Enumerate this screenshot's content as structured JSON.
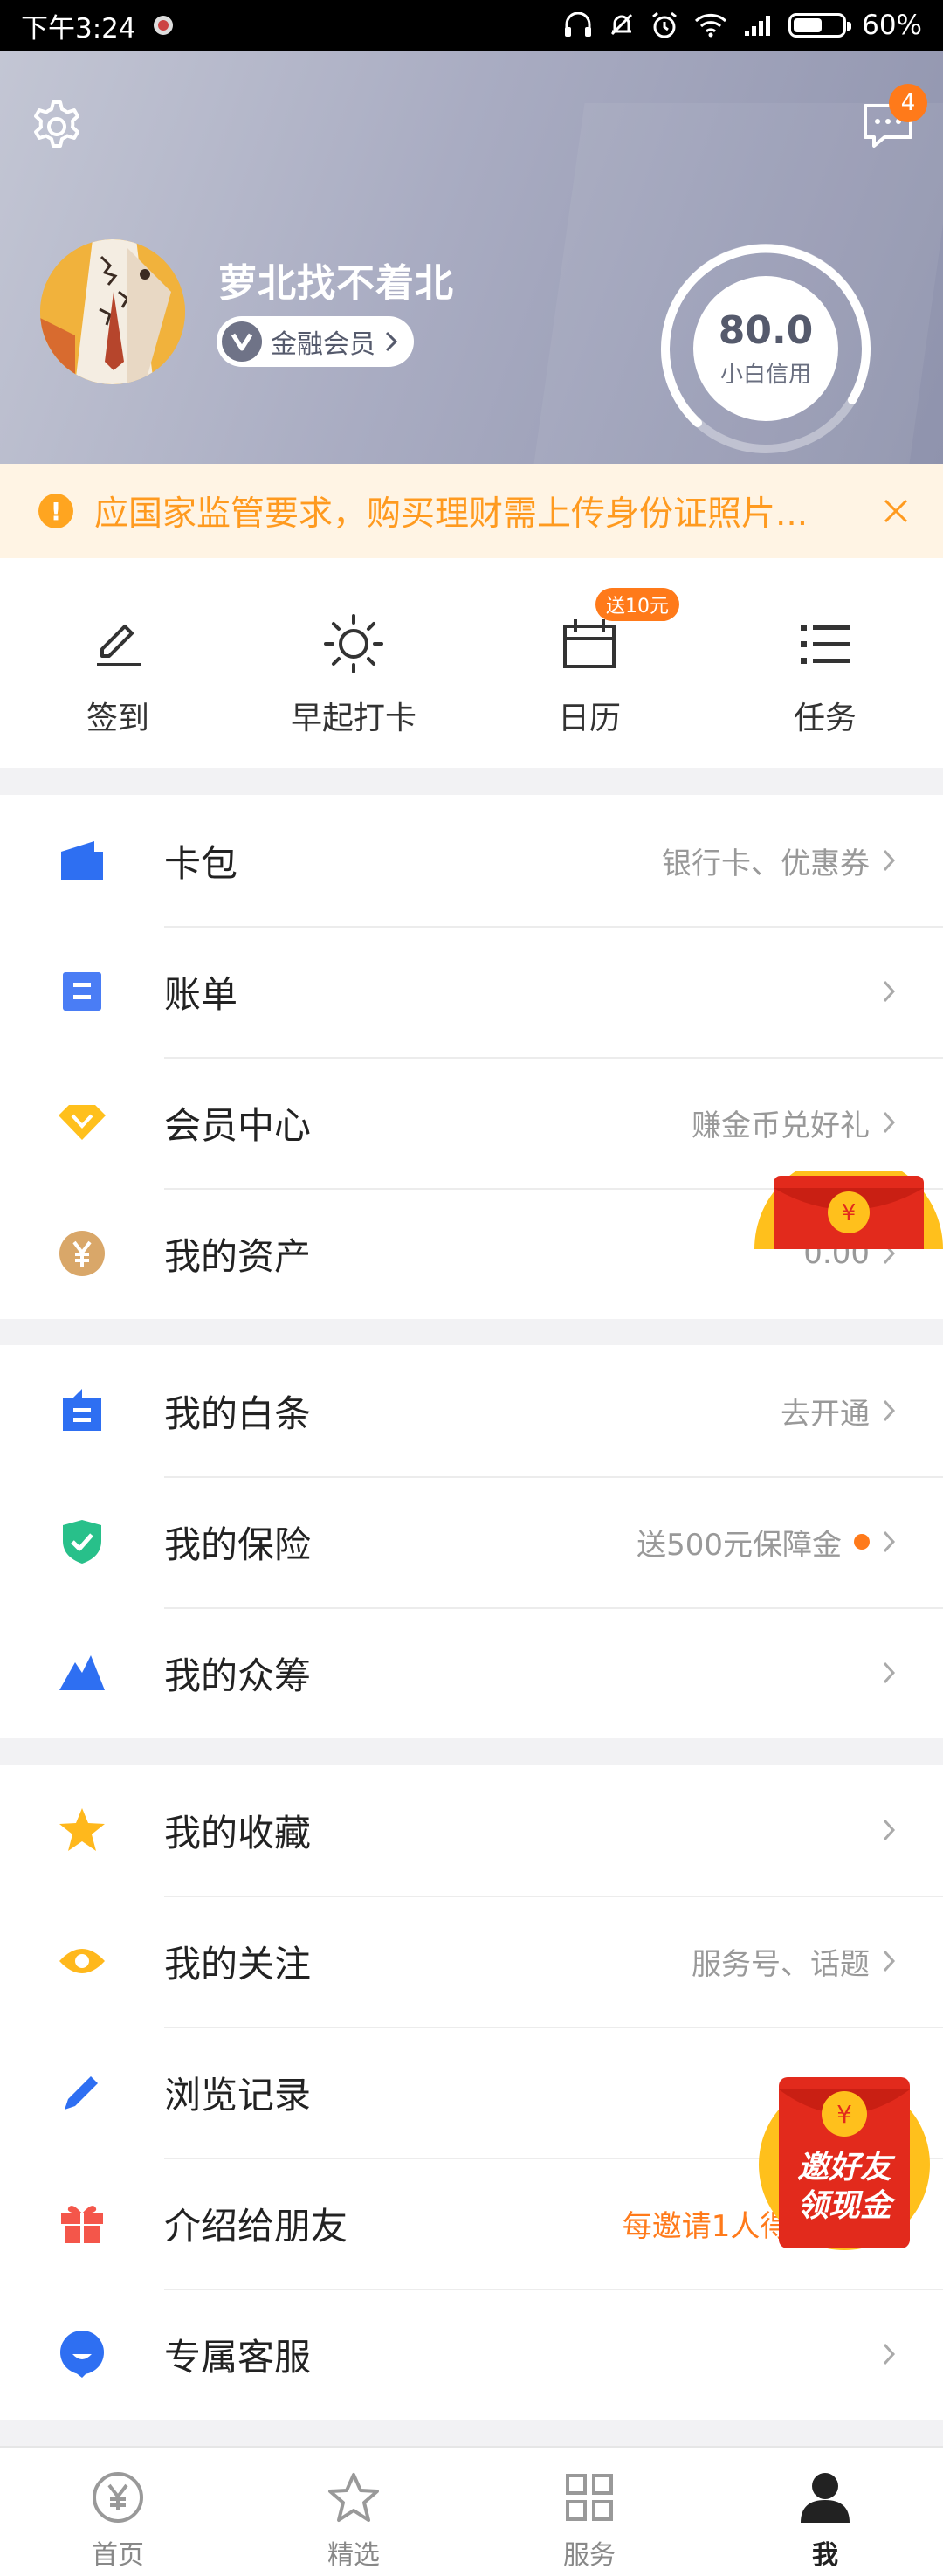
{
  "status_bar": {
    "time": "下午3:24",
    "battery": "60%"
  },
  "header": {
    "username": "萝北找不着北",
    "member_label": "金融会员",
    "message_count": "4",
    "credit_score": "80.0",
    "credit_label": "小白信用"
  },
  "notice": {
    "text": "应国家监管要求，购买理财需上传身份证照片..."
  },
  "quick_actions": [
    {
      "label": "签到",
      "icon": "pen-icon"
    },
    {
      "label": "早起打卡",
      "icon": "sun-icon"
    },
    {
      "label": "日历",
      "icon": "calendar-icon",
      "badge": "送10元"
    },
    {
      "label": "任务",
      "icon": "list-icon"
    }
  ],
  "section1": [
    {
      "title": "卡包",
      "sub": "银行卡、优惠券",
      "icon": "wallet-icon"
    },
    {
      "title": "账单",
      "sub": "",
      "icon": "bill-icon"
    },
    {
      "title": "会员中心",
      "sub": "赚金币兑好礼",
      "icon": "diamond-icon"
    },
    {
      "title": "我的资产",
      "sub": "0.00",
      "icon": "yuan-coin-icon"
    }
  ],
  "section2": [
    {
      "title": "我的白条",
      "sub": "去开通",
      "icon": "ious-icon"
    },
    {
      "title": "我的保险",
      "sub": "送500元保障金",
      "icon": "shield-check-icon"
    },
    {
      "title": "我的众筹",
      "sub": "",
      "icon": "mountain-icon"
    }
  ],
  "section3": [
    {
      "title": "我的收藏",
      "sub": "",
      "icon": "star-icon"
    },
    {
      "title": "我的关注",
      "sub": "服务号、话题",
      "icon": "eye-icon"
    },
    {
      "title": "浏览记录",
      "sub": "",
      "icon": "pencil-icon"
    },
    {
      "title": "介绍给朋友",
      "sub": "每邀请1人得3元",
      "icon": "gift-icon"
    },
    {
      "title": "专属客服",
      "sub": "",
      "icon": "chat-bubble-icon"
    }
  ],
  "invite_badge": {
    "line1": "邀好友",
    "line2": "领现金"
  },
  "bottom_nav": [
    {
      "label": "首页",
      "icon": "home-yuan-icon"
    },
    {
      "label": "精选",
      "icon": "star-outline-icon"
    },
    {
      "label": "服务",
      "icon": "grid-icon"
    },
    {
      "label": "我",
      "icon": "person-icon",
      "active": true
    }
  ],
  "colors": {
    "accent_orange": "#ff7a1a",
    "notice_text": "#ff9a1f",
    "blue_icon": "#2e6ff2",
    "gold_icon": "#ffb81c"
  }
}
